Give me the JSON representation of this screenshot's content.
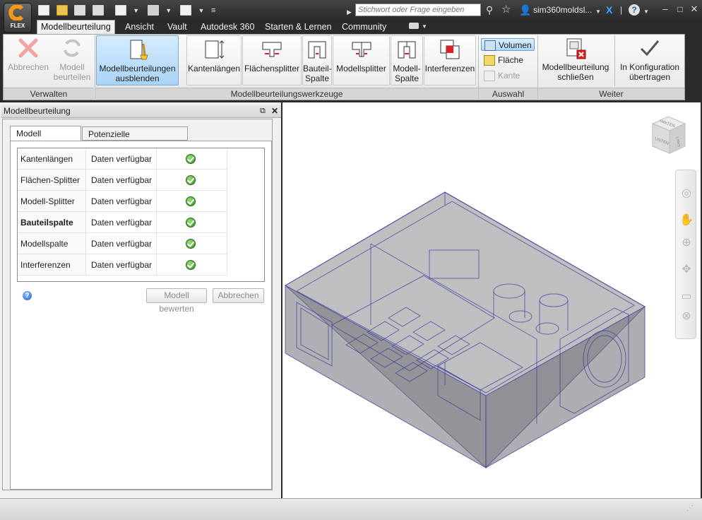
{
  "titlebar": {
    "app_label": "FLEX",
    "search_placeholder": "Stichwort oder Frage eingeben",
    "user": "sim360moldsl..."
  },
  "tabs": [
    {
      "label": "Modellbeurteilung",
      "active": true
    },
    {
      "label": "Ansicht"
    },
    {
      "label": "Vault"
    },
    {
      "label": "Autodesk 360"
    },
    {
      "label": "Starten & Lernen"
    },
    {
      "label": "Community"
    }
  ],
  "ribbon": {
    "verwalten": {
      "title": "Verwalten",
      "abbrechen": "Abbrechen",
      "modell_beurteilen_1": "Modell",
      "modell_beurteilen_2": "beurteilen"
    },
    "werkzeuge": {
      "title": "Modellbeurteilungswerkzeuge",
      "ausblenden_1": "Modellbeurteilungen",
      "ausblenden_2": "ausblenden",
      "kantenlaengen": "Kantenlängen",
      "flaechensplitter": "Flächensplitter",
      "bauteil_spalte_1": "Bauteil-",
      "bauteil_spalte_2": "Spalte",
      "modellsplitter": "Modellsplitter",
      "modell_spalte_1": "Modell-",
      "modell_spalte_2": "Spalte",
      "interferenzen": "Interferenzen"
    },
    "auswahl": {
      "title": "Auswahl",
      "volumen": "Volumen",
      "flaeche": "Fläche",
      "kante": "Kante"
    },
    "weiter": {
      "title": "Weiter",
      "schliessen_1": "Modellbeurteilung",
      "schliessen_2": "schließen",
      "uebertragen_1": "In Konfiguration",
      "uebertragen_2": "übertragen"
    }
  },
  "panel": {
    "title": "Modellbeurteilung",
    "tab_1": "Modell bewerten",
    "tab_2": "Potenzielle Modellprobleme",
    "rows": [
      {
        "name": "Kantenlängen",
        "status": "Daten verfügbar"
      },
      {
        "name": "Flächen-Splitter",
        "status": "Daten verfügbar"
      },
      {
        "name": "Modell-Splitter",
        "status": "Daten verfügbar"
      },
      {
        "name": "Bauteilspalte",
        "status": "Daten verfügbar"
      },
      {
        "name": "Modellspalte",
        "status": "Daten verfügbar"
      },
      {
        "name": "Interferenzen",
        "status": "Daten verfügbar"
      }
    ],
    "btn_bewerten": "Modell bewerten",
    "btn_abbrechen": "Abbrechen"
  },
  "viewcube": {
    "top": "HINTEN",
    "front": "UNTEN",
    "side": "LINKS"
  }
}
